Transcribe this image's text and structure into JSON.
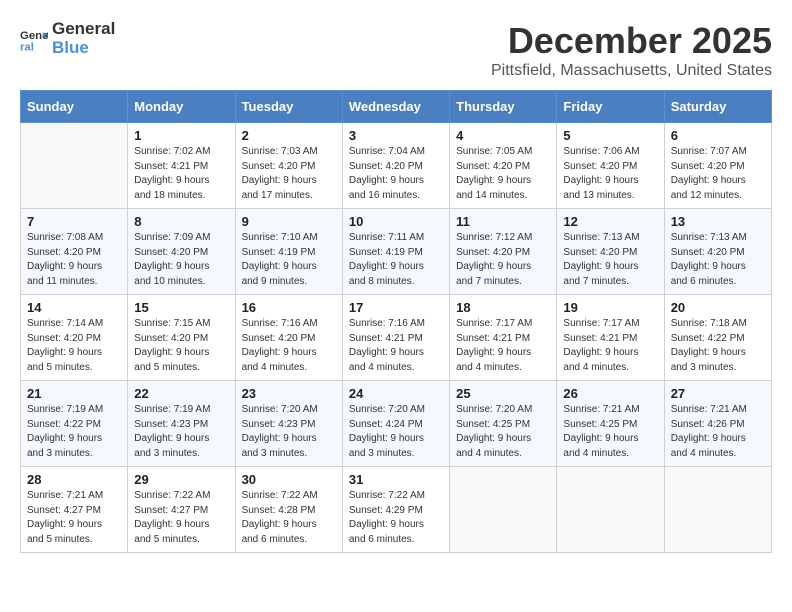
{
  "header": {
    "logo_general": "General",
    "logo_blue": "Blue",
    "month_title": "December 2025",
    "location": "Pittsfield, Massachusetts, United States"
  },
  "weekdays": [
    "Sunday",
    "Monday",
    "Tuesday",
    "Wednesday",
    "Thursday",
    "Friday",
    "Saturday"
  ],
  "weeks": [
    [
      {
        "day": "",
        "sunrise": "",
        "sunset": "",
        "daylight": ""
      },
      {
        "day": "1",
        "sunrise": "Sunrise: 7:02 AM",
        "sunset": "Sunset: 4:21 PM",
        "daylight": "Daylight: 9 hours and 18 minutes."
      },
      {
        "day": "2",
        "sunrise": "Sunrise: 7:03 AM",
        "sunset": "Sunset: 4:20 PM",
        "daylight": "Daylight: 9 hours and 17 minutes."
      },
      {
        "day": "3",
        "sunrise": "Sunrise: 7:04 AM",
        "sunset": "Sunset: 4:20 PM",
        "daylight": "Daylight: 9 hours and 16 minutes."
      },
      {
        "day": "4",
        "sunrise": "Sunrise: 7:05 AM",
        "sunset": "Sunset: 4:20 PM",
        "daylight": "Daylight: 9 hours and 14 minutes."
      },
      {
        "day": "5",
        "sunrise": "Sunrise: 7:06 AM",
        "sunset": "Sunset: 4:20 PM",
        "daylight": "Daylight: 9 hours and 13 minutes."
      },
      {
        "day": "6",
        "sunrise": "Sunrise: 7:07 AM",
        "sunset": "Sunset: 4:20 PM",
        "daylight": "Daylight: 9 hours and 12 minutes."
      }
    ],
    [
      {
        "day": "7",
        "sunrise": "Sunrise: 7:08 AM",
        "sunset": "Sunset: 4:20 PM",
        "daylight": "Daylight: 9 hours and 11 minutes."
      },
      {
        "day": "8",
        "sunrise": "Sunrise: 7:09 AM",
        "sunset": "Sunset: 4:20 PM",
        "daylight": "Daylight: 9 hours and 10 minutes."
      },
      {
        "day": "9",
        "sunrise": "Sunrise: 7:10 AM",
        "sunset": "Sunset: 4:19 PM",
        "daylight": "Daylight: 9 hours and 9 minutes."
      },
      {
        "day": "10",
        "sunrise": "Sunrise: 7:11 AM",
        "sunset": "Sunset: 4:19 PM",
        "daylight": "Daylight: 9 hours and 8 minutes."
      },
      {
        "day": "11",
        "sunrise": "Sunrise: 7:12 AM",
        "sunset": "Sunset: 4:20 PM",
        "daylight": "Daylight: 9 hours and 7 minutes."
      },
      {
        "day": "12",
        "sunrise": "Sunrise: 7:13 AM",
        "sunset": "Sunset: 4:20 PM",
        "daylight": "Daylight: 9 hours and 7 minutes."
      },
      {
        "day": "13",
        "sunrise": "Sunrise: 7:13 AM",
        "sunset": "Sunset: 4:20 PM",
        "daylight": "Daylight: 9 hours and 6 minutes."
      }
    ],
    [
      {
        "day": "14",
        "sunrise": "Sunrise: 7:14 AM",
        "sunset": "Sunset: 4:20 PM",
        "daylight": "Daylight: 9 hours and 5 minutes."
      },
      {
        "day": "15",
        "sunrise": "Sunrise: 7:15 AM",
        "sunset": "Sunset: 4:20 PM",
        "daylight": "Daylight: 9 hours and 5 minutes."
      },
      {
        "day": "16",
        "sunrise": "Sunrise: 7:16 AM",
        "sunset": "Sunset: 4:20 PM",
        "daylight": "Daylight: 9 hours and 4 minutes."
      },
      {
        "day": "17",
        "sunrise": "Sunrise: 7:16 AM",
        "sunset": "Sunset: 4:21 PM",
        "daylight": "Daylight: 9 hours and 4 minutes."
      },
      {
        "day": "18",
        "sunrise": "Sunrise: 7:17 AM",
        "sunset": "Sunset: 4:21 PM",
        "daylight": "Daylight: 9 hours and 4 minutes."
      },
      {
        "day": "19",
        "sunrise": "Sunrise: 7:17 AM",
        "sunset": "Sunset: 4:21 PM",
        "daylight": "Daylight: 9 hours and 4 minutes."
      },
      {
        "day": "20",
        "sunrise": "Sunrise: 7:18 AM",
        "sunset": "Sunset: 4:22 PM",
        "daylight": "Daylight: 9 hours and 3 minutes."
      }
    ],
    [
      {
        "day": "21",
        "sunrise": "Sunrise: 7:19 AM",
        "sunset": "Sunset: 4:22 PM",
        "daylight": "Daylight: 9 hours and 3 minutes."
      },
      {
        "day": "22",
        "sunrise": "Sunrise: 7:19 AM",
        "sunset": "Sunset: 4:23 PM",
        "daylight": "Daylight: 9 hours and 3 minutes."
      },
      {
        "day": "23",
        "sunrise": "Sunrise: 7:20 AM",
        "sunset": "Sunset: 4:23 PM",
        "daylight": "Daylight: 9 hours and 3 minutes."
      },
      {
        "day": "24",
        "sunrise": "Sunrise: 7:20 AM",
        "sunset": "Sunset: 4:24 PM",
        "daylight": "Daylight: 9 hours and 3 minutes."
      },
      {
        "day": "25",
        "sunrise": "Sunrise: 7:20 AM",
        "sunset": "Sunset: 4:25 PM",
        "daylight": "Daylight: 9 hours and 4 minutes."
      },
      {
        "day": "26",
        "sunrise": "Sunrise: 7:21 AM",
        "sunset": "Sunset: 4:25 PM",
        "daylight": "Daylight: 9 hours and 4 minutes."
      },
      {
        "day": "27",
        "sunrise": "Sunrise: 7:21 AM",
        "sunset": "Sunset: 4:26 PM",
        "daylight": "Daylight: 9 hours and 4 minutes."
      }
    ],
    [
      {
        "day": "28",
        "sunrise": "Sunrise: 7:21 AM",
        "sunset": "Sunset: 4:27 PM",
        "daylight": "Daylight: 9 hours and 5 minutes."
      },
      {
        "day": "29",
        "sunrise": "Sunrise: 7:22 AM",
        "sunset": "Sunset: 4:27 PM",
        "daylight": "Daylight: 9 hours and 5 minutes."
      },
      {
        "day": "30",
        "sunrise": "Sunrise: 7:22 AM",
        "sunset": "Sunset: 4:28 PM",
        "daylight": "Daylight: 9 hours and 6 minutes."
      },
      {
        "day": "31",
        "sunrise": "Sunrise: 7:22 AM",
        "sunset": "Sunset: 4:29 PM",
        "daylight": "Daylight: 9 hours and 6 minutes."
      },
      {
        "day": "",
        "sunrise": "",
        "sunset": "",
        "daylight": ""
      },
      {
        "day": "",
        "sunrise": "",
        "sunset": "",
        "daylight": ""
      },
      {
        "day": "",
        "sunrise": "",
        "sunset": "",
        "daylight": ""
      }
    ]
  ]
}
